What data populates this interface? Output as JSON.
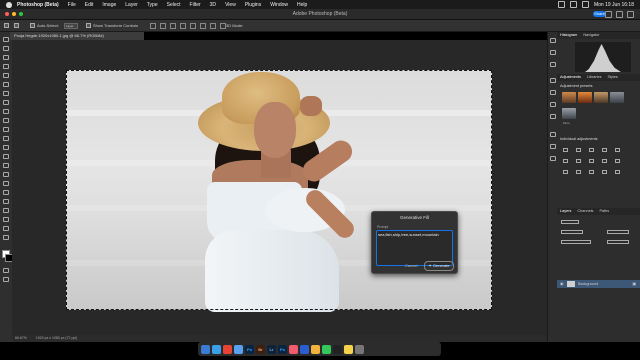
{
  "menubar": {
    "app_name": "Photoshop (Beta)",
    "items": [
      "File",
      "Edit",
      "Image",
      "Layer",
      "Type",
      "Select",
      "Filter",
      "3D",
      "View",
      "Plugins",
      "Window",
      "Help"
    ],
    "clock": "Mon 19 Jun 16:18"
  },
  "titlebar": {
    "title": "Adobe Photoshop (Beta)",
    "share_label": "Share"
  },
  "options": {
    "auto_select_label": "Auto-Select:",
    "auto_select_value": "Layer",
    "transform_label": "Show Transform Controls",
    "mode_label": "3D Mode:"
  },
  "document": {
    "tab_label": "Pooja Hegde-1920x1080-1.jpg @ 66.7% (RGB/8#)",
    "zoom": "66.67%",
    "doc_info": "1920 px x 1080 px (72 ppi)"
  },
  "genfill": {
    "title": "Generative Fill",
    "prompt_label": "Prompt",
    "prompt_value": "sea,fish,ship,tree,sunset,mountain",
    "cancel_label": "Cancel",
    "generate_label": "Generate"
  },
  "panels": {
    "tab_histogram": "Histogram",
    "tab_navigator": "Navigator",
    "tab_adjustments": "Adjustments",
    "tab_libraries": "Libraries",
    "tab_styles": "Styles",
    "presets_label": "Adjustment presets",
    "preset_more": "More",
    "individual_label": "Individual adjustments",
    "tab_layers": "Layers",
    "tab_channels": "Channels",
    "tab_paths": "Paths",
    "layer_name": "Background"
  },
  "dock": {
    "apps": [
      "Finder",
      "Safari",
      "Chrome",
      "Mail",
      "Ps",
      "Br",
      "Lr",
      "Ps",
      "Music",
      "Xcode",
      "Photos",
      "Messages",
      "Terminal",
      "Notes",
      "Trash"
    ]
  },
  "colors": {
    "accent": "#1473e6",
    "ui_dark": "#2d2d2d",
    "selected_layer": "#3d5777"
  }
}
